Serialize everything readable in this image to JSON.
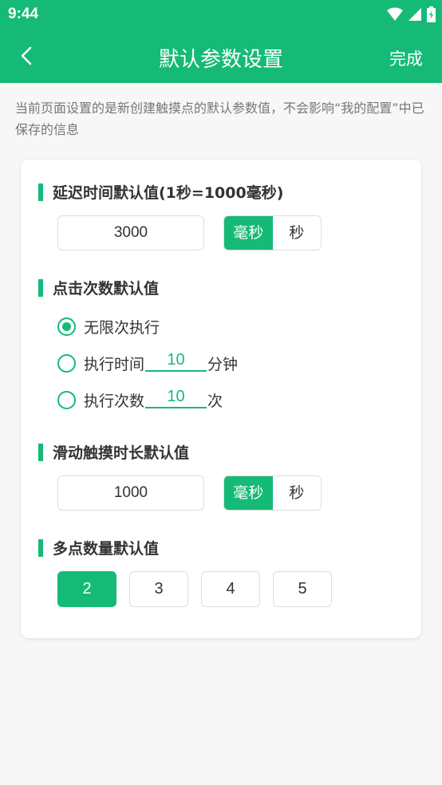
{
  "status_bar": {
    "time": "9:44"
  },
  "header": {
    "title": "默认参数设置",
    "done_label": "完成"
  },
  "notice": "当前页面设置的是新创建触摸点的默认参数值，不会影响“我的配置”中已保存的信息",
  "delay": {
    "title": "延迟时间默认值(1秒=1000毫秒)",
    "value": "3000",
    "units": [
      "毫秒",
      "秒"
    ],
    "selected_unit": "毫秒"
  },
  "click_count": {
    "title": "点击次数默认值",
    "options": {
      "unlimited": "无限次执行",
      "time_label": "执行时间",
      "time_value": "10",
      "time_unit": "分钟",
      "count_label": "执行次数",
      "count_value": "10",
      "count_unit": "次"
    },
    "selected": "unlimited"
  },
  "swipe": {
    "title": "滑动触摸时长默认值",
    "value": "1000",
    "units": [
      "毫秒",
      "秒"
    ],
    "selected_unit": "毫秒"
  },
  "multi_point": {
    "title": "多点数量默认值",
    "options": [
      "2",
      "3",
      "4",
      "5"
    ],
    "selected": "2"
  },
  "colors": {
    "accent": "#15ba77",
    "background": "#f7f7f7"
  }
}
